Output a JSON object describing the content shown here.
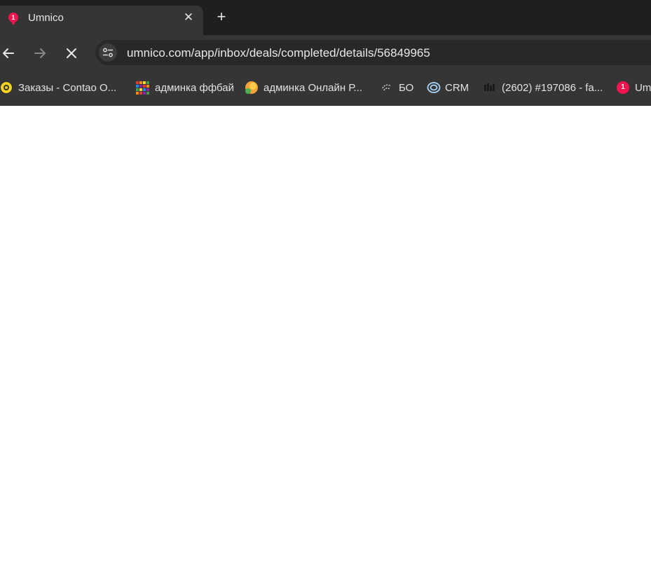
{
  "tab": {
    "title": "Umnico",
    "favicon_badge": "1",
    "favicon_color": "#f0154f",
    "close_glyph": "✕"
  },
  "new_tab_glyph": "+",
  "toolbar": {
    "back_icon": "arrow-left-icon",
    "forward_icon": "arrow-right-icon",
    "stop_icon": "close-icon",
    "site_info_icon": "tune-icon",
    "url": "umnico.com/app/inbox/deals/completed/details/56849965"
  },
  "bookmarks": [
    {
      "label": "Заказы - Contao O...",
      "icon": "orders-icon"
    },
    {
      "label": "админка ффбай",
      "icon": "grid-icon"
    },
    {
      "label": "админка Онлайн Р...",
      "icon": "online-icon"
    },
    {
      "label": "БО",
      "icon": "bo-icon"
    },
    {
      "label": "CRM",
      "icon": "crm-icon"
    },
    {
      "label": "(2602) #197086 - fa...",
      "icon": "ticket-icon"
    },
    {
      "label": "Um",
      "icon": "umnico-icon",
      "badge": "1"
    }
  ],
  "colors": {
    "tabstrip_bg": "#1f1f1f",
    "toolbar_bg": "#353535",
    "omnibox_bg": "#282828",
    "page_bg": "#ffffff",
    "brand": "#f0154f"
  }
}
